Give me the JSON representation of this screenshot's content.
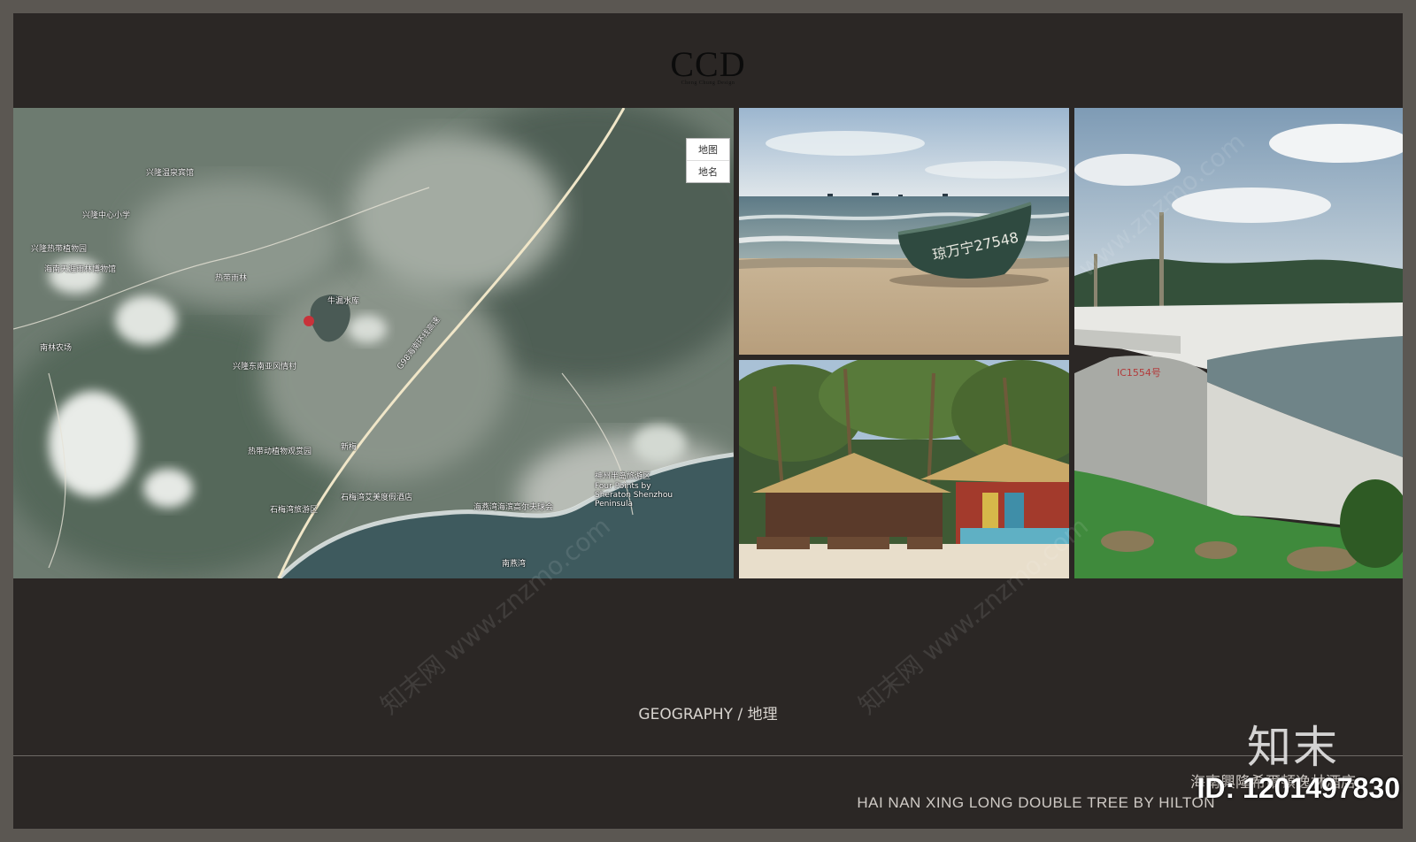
{
  "logo": {
    "main": "CCD",
    "sub": "Cheng Chung Design"
  },
  "map": {
    "controls": [
      "地图",
      "地名"
    ],
    "labels": [
      "兴隆温泉宾馆",
      "兴隆热带植物园",
      "兴隆中心小学",
      "海南天涯雨林博物馆",
      "兴隆东南亚风情村",
      "热带雨林",
      "牛漏水库",
      "热带动植物观赏园",
      "新梅",
      "石梅湾艾美度假酒店",
      "石梅湾旅游区",
      "南燕湾",
      "海燕湾海滨高尔夫球会",
      "神州半岛旅游区",
      "Four Points by Sheraton Shenzhou Peninsula",
      "南林农场",
      "G98海南环线高速"
    ]
  },
  "caption": {
    "en": "GEOGRAPHY / 地理"
  },
  "hotel": {
    "cn": "海南興隆希爾頓逸林酒店",
    "en": "HAI NAN XING LONG DOUBLE TREE BY HILTON"
  },
  "watermark": {
    "brand": "知末",
    "id": "ID: 1201497830"
  },
  "boat_number": "琼万宁27548",
  "wall_mark": "IC1554号"
}
